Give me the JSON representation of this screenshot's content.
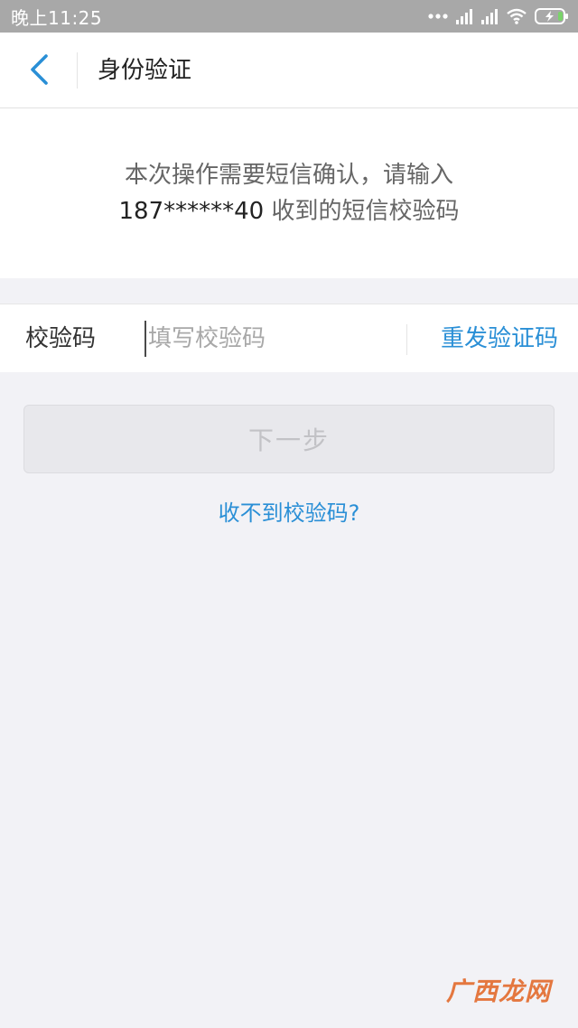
{
  "status_bar": {
    "time": "晚上11:25",
    "icons": [
      "more-dots-icon",
      "signal-icon",
      "signal-icon",
      "wifi-icon",
      "battery-charging-icon"
    ]
  },
  "nav": {
    "back_icon": "chevron-left-icon",
    "title": "身份验证"
  },
  "message": {
    "line1": "本次操作需要短信确认，请输入",
    "phone": "187******40",
    "line2_suffix": " 收到的短信校验码"
  },
  "input_row": {
    "label": "校验码",
    "placeholder": "填写校验码",
    "value": "",
    "resend_label": "重发验证码"
  },
  "next_button": {
    "label": "下一步",
    "enabled": false
  },
  "help_link": {
    "label": "收不到校验码?"
  },
  "watermark": {
    "text": "广西龙网"
  },
  "colors": {
    "accent": "#2a8fd6",
    "background": "#f2f2f6",
    "status_bar": "#a8a8a8",
    "watermark": "#e36a2c"
  }
}
